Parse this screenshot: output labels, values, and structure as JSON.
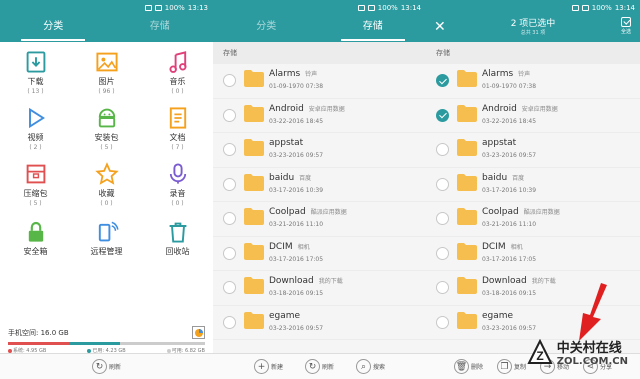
{
  "colors": {
    "accent": "#2b9ba0",
    "folder": "#f6be4f",
    "arrow": "#e02020"
  },
  "status": [
    {
      "battery": "100%",
      "time": "13:13"
    },
    {
      "battery": "100%",
      "time": "13:14"
    },
    {
      "battery": "100%",
      "time": "13:14"
    }
  ],
  "panel1": {
    "tabs": [
      "分类",
      "存储"
    ],
    "grid": [
      {
        "label": "下载",
        "count": "( 13 )",
        "icon": "download-icon",
        "color": "#2b9ba0"
      },
      {
        "label": "图片",
        "count": "( 96 )",
        "icon": "image-icon",
        "color": "#f4a11e"
      },
      {
        "label": "音乐",
        "count": "( 0 )",
        "icon": "music-icon",
        "color": "#e0407a"
      },
      {
        "label": "视频",
        "count": "( 2 )",
        "icon": "video-icon",
        "color": "#3f8ee0"
      },
      {
        "label": "安装包",
        "count": "( 5 )",
        "icon": "android-icon",
        "color": "#58b648"
      },
      {
        "label": "文档",
        "count": "( 7 )",
        "icon": "document-icon",
        "color": "#f4a11e"
      },
      {
        "label": "压缩包",
        "count": "( 5 )",
        "icon": "archive-icon",
        "color": "#e05050"
      },
      {
        "label": "收藏",
        "count": "( 0 )",
        "icon": "star-icon",
        "color": "#f4a11e"
      },
      {
        "label": "录音",
        "count": "( 0 )",
        "icon": "microphone-icon",
        "color": "#7a5cd0"
      },
      {
        "label": "安全箱",
        "count": "",
        "icon": "lock-icon",
        "color": "#58b648"
      },
      {
        "label": "远程管理",
        "count": "",
        "icon": "remote-icon",
        "color": "#3f8ee0"
      },
      {
        "label": "回收站",
        "count": "",
        "icon": "trash-icon",
        "color": "#2b9ba0"
      }
    ],
    "storage": {
      "title": "手机空间: 16.0 GB",
      "legend": [
        {
          "label": "系统: 4.95 GB",
          "color": "#e05050",
          "fraction": 0.31
        },
        {
          "label": "已用: 4.23 GB",
          "color": "#2b9ba0",
          "fraction": 0.26
        },
        {
          "label": "可用: 6.82 GB",
          "color": "#cccccc",
          "fraction": 0.43
        }
      ]
    },
    "bottom": [
      "刷新"
    ]
  },
  "panel2": {
    "tabs": [
      "分类",
      "存储"
    ],
    "section": "存储",
    "bottom": [
      "新建",
      "刷新",
      "搜索"
    ]
  },
  "panel3": {
    "title": "2 项已选中",
    "subtitle": "总共 31 项",
    "select_all": "全选",
    "section": "存储",
    "bottom": [
      "删除",
      "复制",
      "移动",
      "分享"
    ]
  },
  "folders": [
    {
      "name": "Alarms",
      "desc": "铃声",
      "date": "01-09-1970 07:38",
      "selected": true
    },
    {
      "name": "Android",
      "desc": "安卓应用数据",
      "date": "03-22-2016 18:45",
      "selected": true
    },
    {
      "name": "appstat",
      "desc": "",
      "date": "03-23-2016 09:57",
      "selected": false
    },
    {
      "name": "baidu",
      "desc": "百度",
      "date": "03-17-2016 10:39",
      "selected": false
    },
    {
      "name": "Coolpad",
      "desc": "酷派应用数据",
      "date": "03-21-2016 11:10",
      "selected": false
    },
    {
      "name": "DCIM",
      "desc": "相机",
      "date": "03-17-2016 17:05",
      "selected": false
    },
    {
      "name": "Download",
      "desc": "我的下载",
      "date": "03-18-2016 09:15",
      "selected": false
    },
    {
      "name": "egame",
      "desc": "",
      "date": "03-23-2016 09:57",
      "selected": false
    }
  ],
  "watermark": {
    "line1": "中关村在线",
    "line2": "ZOL.COM.CN"
  }
}
